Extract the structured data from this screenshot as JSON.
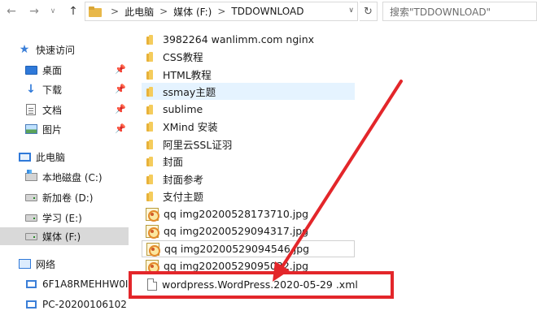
{
  "toolbar": {
    "back_glyph": "←",
    "forward_glyph": "→",
    "recent_glyph": "∨",
    "up_glyph": "↑",
    "back_icon": "back-arrow-icon",
    "forward_icon": "forward-arrow-icon",
    "up_icon": "up-arrow-icon"
  },
  "address": {
    "sep": ">",
    "parts": [
      "此电脑",
      "媒体 (F:)",
      "TDDOWNLOAD"
    ],
    "dropdown_glyph": "∨",
    "refresh_glyph": "↻"
  },
  "search": {
    "placeholder": "搜索\"TDDOWNLOAD\""
  },
  "sidebar": {
    "pin_glyph": "📌",
    "items": [
      {
        "label": "快速访问",
        "icon": "star-icon"
      },
      {
        "label": "桌面",
        "icon": "desktop-icon",
        "pinned": true
      },
      {
        "label": "下载",
        "icon": "download-icon",
        "pinned": true
      },
      {
        "label": "文档",
        "icon": "document-icon",
        "pinned": true
      },
      {
        "label": "图片",
        "icon": "picture-icon",
        "pinned": true
      },
      {
        "label": "此电脑",
        "icon": "computer-icon"
      },
      {
        "label": "本地磁盘 (C:)",
        "icon": "drive-icon"
      },
      {
        "label": "新加卷 (D:)",
        "icon": "drive-icon"
      },
      {
        "label": "学习 (E:)",
        "icon": "drive-icon"
      },
      {
        "label": "媒体 (F:)",
        "icon": "drive-icon",
        "selected": true
      },
      {
        "label": "网络",
        "icon": "network-icon"
      },
      {
        "label": "6F1A8RMEHHW0I",
        "icon": "network-computer-icon"
      },
      {
        "label": "PC-20200106102",
        "icon": "network-computer-icon"
      }
    ]
  },
  "files": [
    {
      "name": "3982264 wanlimm.com nginx",
      "type": "folder"
    },
    {
      "name": "CSS教程",
      "type": "folder"
    },
    {
      "name": "HTML教程",
      "type": "folder"
    },
    {
      "name": "ssmay主题",
      "type": "folder",
      "hover": true
    },
    {
      "name": "sublime",
      "type": "folder"
    },
    {
      "name": "XMind 安装",
      "type": "folder"
    },
    {
      "name": "阿里云SSL证羽",
      "type": "folder"
    },
    {
      "name": "封面",
      "type": "folder"
    },
    {
      "name": "封面参考",
      "type": "folder"
    },
    {
      "name": "支付主题",
      "type": "folder"
    },
    {
      "name": "qq  img20200528173710.jpg",
      "type": "jpg"
    },
    {
      "name": "qq  img20200529094317.jpg",
      "type": "jpg"
    },
    {
      "name": "qq  img20200529094546.jpg",
      "type": "jpg",
      "boxed": true
    },
    {
      "name": "qq  img20200529095032.jpg",
      "type": "jpg"
    },
    {
      "name": "wordpress.WordPress.2020-05-29 .xml",
      "type": "file"
    }
  ],
  "annotation": {
    "color": "#e3262a"
  }
}
